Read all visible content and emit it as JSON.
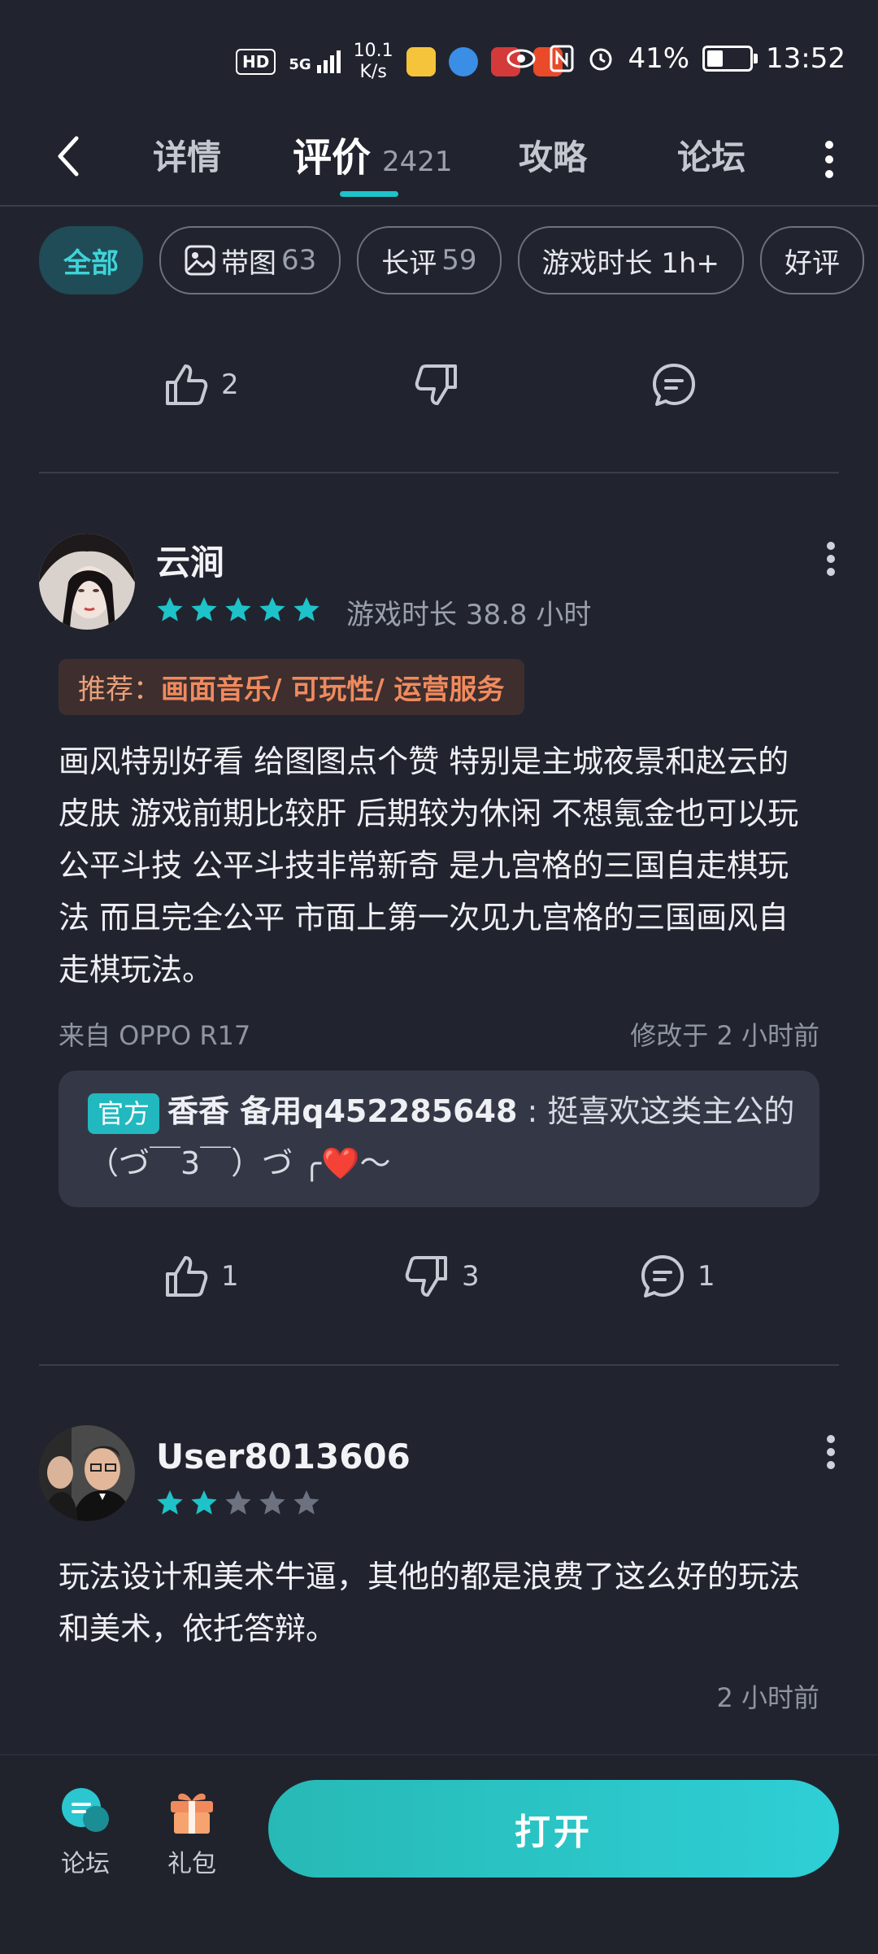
{
  "status_bar": {
    "hd": "HD",
    "signal": "5G",
    "net_speed_value": "10.1",
    "net_speed_unit": "K/s",
    "battery": "41%",
    "battery_level": 0.41,
    "time": "13:52"
  },
  "nav": {
    "tabs": [
      {
        "label": "详情"
      },
      {
        "label": "评价",
        "count": "2421"
      },
      {
        "label": "攻略"
      },
      {
        "label": "论坛"
      }
    ]
  },
  "filters": [
    {
      "label": "全部"
    },
    {
      "label": "带图",
      "count": "63"
    },
    {
      "label": "长评",
      "count": "59"
    },
    {
      "label": "游戏时长 1h+"
    },
    {
      "label": "好评"
    }
  ],
  "prev_actions": {
    "likes": "2"
  },
  "reviews": [
    {
      "username": "云涧",
      "rating": 5,
      "playtime": "游戏时长 38.8 小时",
      "recommend_prefix": "推荐：",
      "recommend_items": "画面音乐/ 可玩性/ 运营服务",
      "content": "画风特别好看 给图图点个赞 特别是主城夜景和赵云的皮肤 游戏前期比较肝 后期较为休闲 不想氪金也可以玩公平斗技 公平斗技非常新奇 是九宫格的三国自走棋玩法 而且完全公平 市面上第一次见九宫格的三国画风自走棋玩法。",
      "device": "来自 OPPO R17",
      "modified": "修改于 2 小时前",
      "reply": {
        "tag": "官方",
        "author": "香香 备用q452285648",
        "separator": " : ",
        "text": "挺喜欢这类主公的（づ￣3￣）づ ╭❤️～"
      },
      "likes": "1",
      "dislikes": "3",
      "comments": "1"
    },
    {
      "username": "User8013606",
      "rating": 2,
      "content": "玩法设计和美术牛逼，其他的都是浪费了这么好的玩法和美术，依托答辩。",
      "time": "2 小时前"
    }
  ],
  "bottom_bar": {
    "forum_label": "论坛",
    "gift_label": "礼包",
    "open_label": "打开"
  },
  "colors": {
    "background": "#21242e",
    "accent": "#1ec3c9",
    "star_on": "#1ec3c9",
    "star_off": "#6d7280",
    "recommend": "#f08a5d"
  }
}
